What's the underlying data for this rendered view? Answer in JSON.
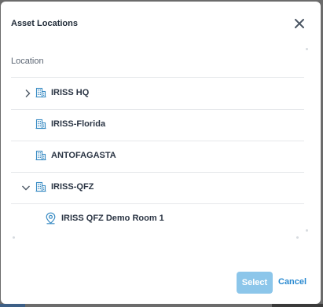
{
  "dialog": {
    "title": "Asset Locations",
    "close_icon": "close-icon"
  },
  "table": {
    "column_header": "Location"
  },
  "locations": [
    {
      "label": "IRISS HQ",
      "icon": "building-icon",
      "chevron": "chevron-right-icon",
      "expanded": false
    },
    {
      "label": "IRISS-Florida",
      "icon": "building-icon"
    },
    {
      "label": "ANTOFAGASTA",
      "icon": "building-icon"
    },
    {
      "label": "IRISS-QFZ",
      "icon": "building-icon",
      "chevron": "chevron-down-icon",
      "expanded": true
    },
    {
      "label": "IRISS QFZ Demo Room 1",
      "icon": "location-pin-icon",
      "child_of": "IRISS-QFZ"
    }
  ],
  "footer": {
    "select_label": "Select",
    "cancel_label": "Cancel",
    "select_enabled": false
  },
  "colors": {
    "accent": "#2a8ad1",
    "select_disabled": "#8cc6ea",
    "icon": "#3a8cc4",
    "text": "#2b3544",
    "divider": "#e6e8eb"
  }
}
